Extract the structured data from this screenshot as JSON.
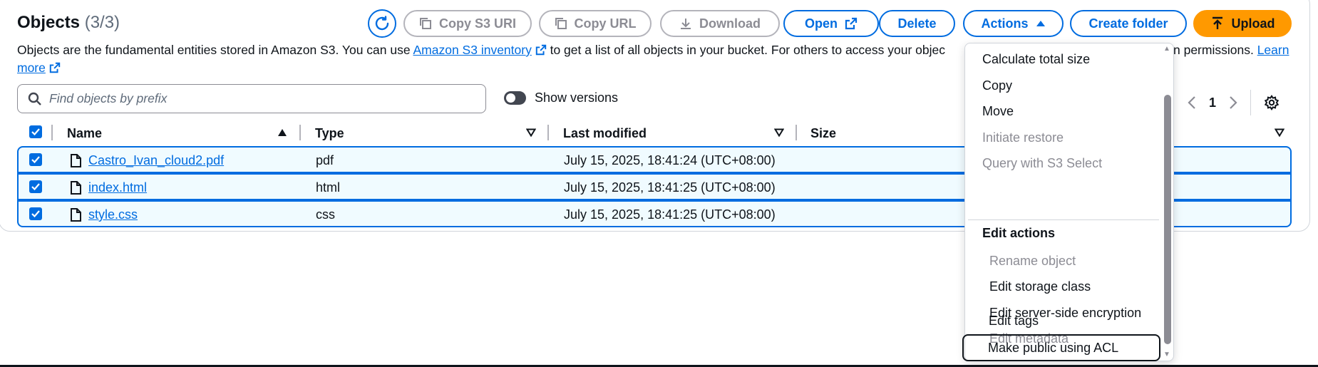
{
  "header": {
    "title": "Objects",
    "count": "(3/3)",
    "buttons": {
      "copy_s3_uri": "Copy S3 URI",
      "copy_url": "Copy URL",
      "download": "Download",
      "open": "Open",
      "delete": "Delete",
      "actions": "Actions",
      "create_folder": "Create folder",
      "upload": "Upload"
    }
  },
  "description": {
    "part1": "Objects are the fundamental entities stored in Amazon S3. You can use ",
    "inventory_link": "Amazon S3 inventory",
    "part2": " to get a list of all objects in your bucket. For others to access your objec",
    "part3": "n permissions. ",
    "learn_more": "Learn more"
  },
  "search": {
    "placeholder": "Find objects by prefix"
  },
  "show_versions": "Show versions",
  "pager": {
    "current_page": "1"
  },
  "table": {
    "columns": [
      "Name",
      "Type",
      "Last modified",
      "Size"
    ],
    "rows": [
      {
        "name": "Castro_Ivan_cloud2.pdf",
        "type": "pdf",
        "modified": "July 15, 2025, 18:41:24 (UTC+08:00)"
      },
      {
        "name": "index.html",
        "type": "html",
        "modified": "July 15, 2025, 18:41:25 (UTC+08:00)"
      },
      {
        "name": "style.css",
        "type": "css",
        "modified": "July 15, 2025, 18:41:25 (UTC+08:00)"
      }
    ]
  },
  "actions_menu": {
    "items": [
      {
        "label": "Calculate total size",
        "disabled": false
      },
      {
        "label": "Copy",
        "disabled": false
      },
      {
        "label": "Move",
        "disabled": false
      },
      {
        "label": "Initiate restore",
        "disabled": true
      },
      {
        "label": "Query with S3 Select",
        "disabled": true
      }
    ],
    "group_label": "Edit actions",
    "edit_items": [
      {
        "label": "Rename object",
        "disabled": true
      },
      {
        "label": "Edit storage class",
        "disabled": false
      },
      {
        "label": "Edit server-side encryption",
        "disabled": false
      },
      {
        "label": "Edit metadata",
        "disabled": true
      },
      {
        "label": "Edit tags",
        "disabled": false
      },
      {
        "label": "Make public using ACL",
        "disabled": false,
        "focused": true
      }
    ]
  },
  "colors": {
    "accent": "#006ce0",
    "primary": "#ff9900",
    "selected_row": "#f0fbff",
    "disabled": "#8c8c94"
  }
}
